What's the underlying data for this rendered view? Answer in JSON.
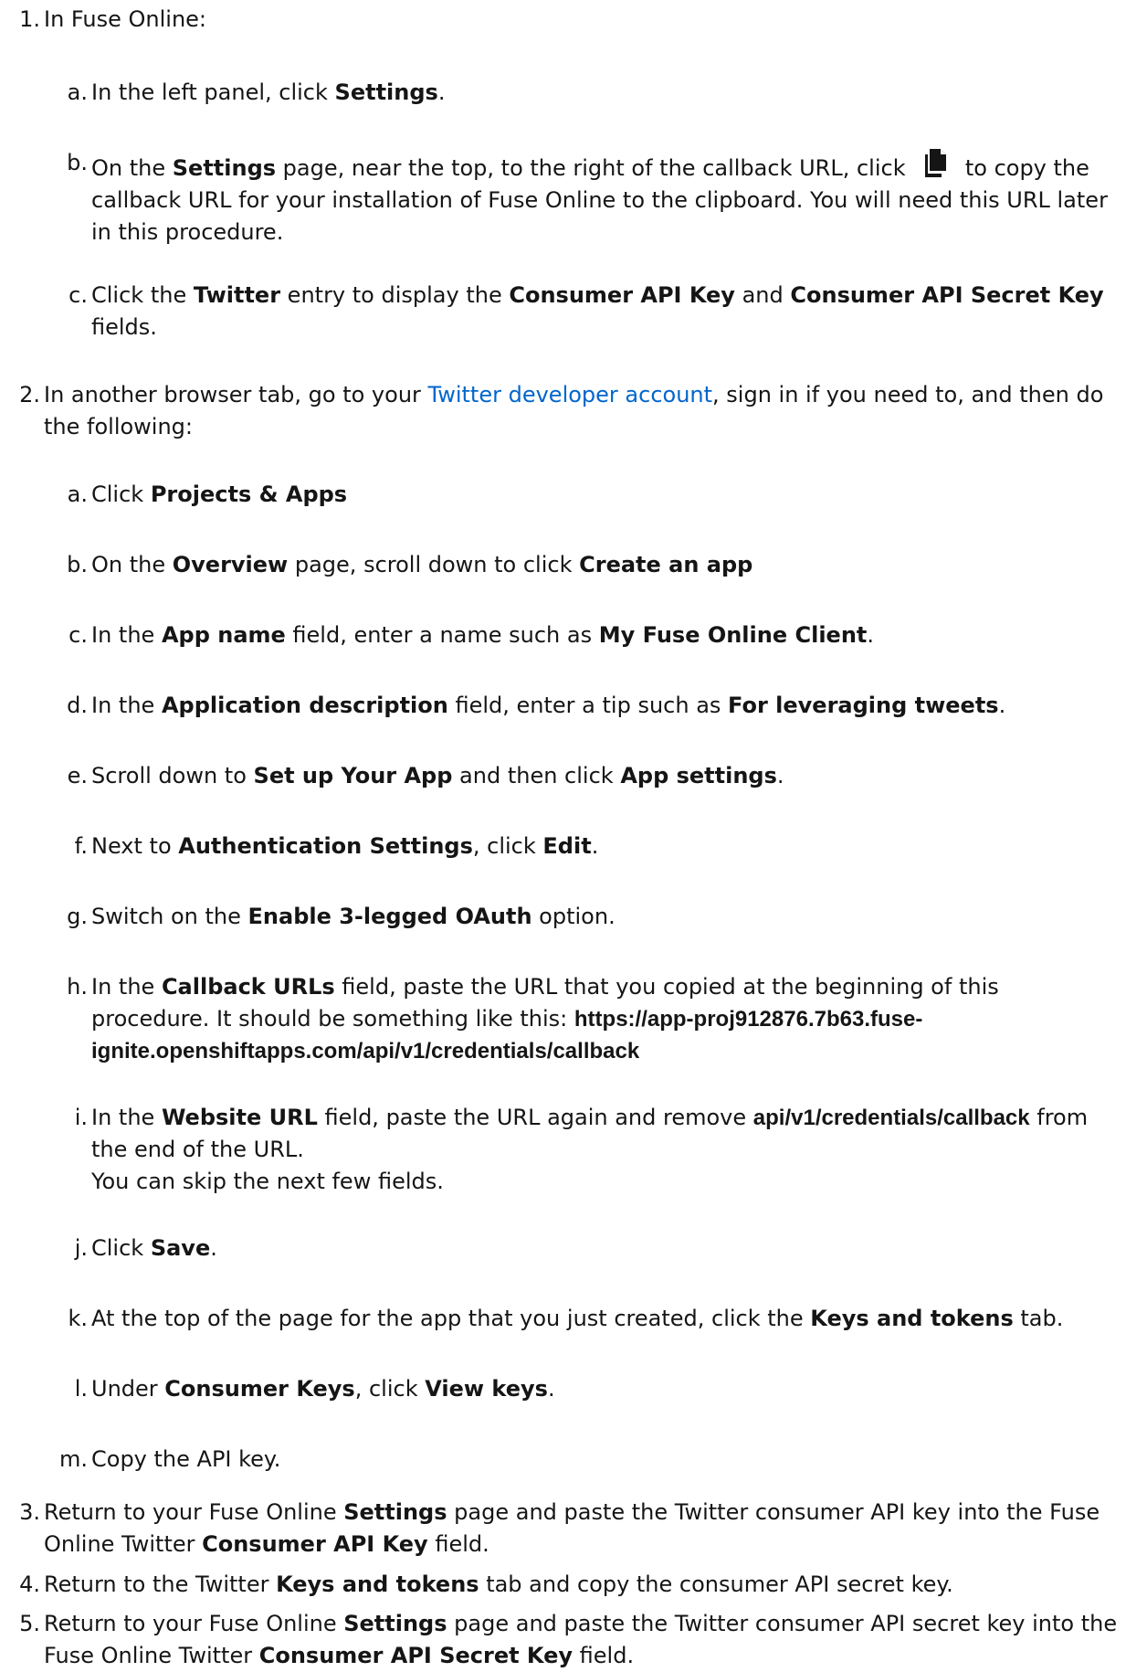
{
  "steps": [
    {
      "number": "1.",
      "text": "In Fuse Online:",
      "sub": [
        {
          "letter": "a.",
          "t1": "In the left panel, click ",
          "b1": "Settings",
          "t2": "."
        },
        {
          "letter": "b.",
          "t1": "On the ",
          "b1": "Settings",
          "t2": " page, near the top, to the right of the callback URL, click ",
          "icon": "copy-icon",
          "t3": " to copy the callback URL for your installation of Fuse Online to the clipboard. You will need this URL later in this procedure."
        },
        {
          "letter": "c.",
          "t1": "Click the ",
          "b1": "Twitter",
          "t2": " entry to display the ",
          "b2": "Consumer API Key",
          "t3": " and ",
          "b3": "Consumer API Secret Key",
          "t4": " fields."
        }
      ]
    },
    {
      "number": "2.",
      "t1": "In another browser tab, go to your ",
      "link": "Twitter developer account",
      "t2": ", sign in if you need to, and then do the following:",
      "sub": [
        {
          "letter": "a.",
          "t1": "Click ",
          "b1": "Projects & Apps"
        },
        {
          "letter": "b.",
          "t1": "On the ",
          "b1": "Overview",
          "t2": " page, scroll down to click ",
          "b2": "Create an app"
        },
        {
          "letter": "c.",
          "t1": "In the ",
          "b1": "App name",
          "t2": " field, enter a name such as ",
          "b2": "My Fuse Online Client",
          "t3": "."
        },
        {
          "letter": "d.",
          "t1": "In the ",
          "b1": "Application description",
          "t2": " field, enter a tip such as ",
          "b2": "For leveraging tweets",
          "t3": "."
        },
        {
          "letter": "e.",
          "t1": "Scroll down to ",
          "b1": "Set up Your App",
          "t2": " and then click ",
          "b2": "App settings",
          "t3": "."
        },
        {
          "letter": "f.",
          "t1": "Next to ",
          "b1": "Authentication Settings",
          "t2": ", click ",
          "b2": "Edit",
          "t3": "."
        },
        {
          "letter": "g.",
          "t1": "Switch on the ",
          "b1": "Enable 3-legged OAuth",
          "t2": " option."
        },
        {
          "letter": "h.",
          "t1": "In the ",
          "b1": "Callback URLs",
          "t2": " field, paste the URL that you copied at the beginning of this procedure. It should be something like this: ",
          "code": "https://app-proj912876.7b63.fuse-ignite.openshiftapps.com/api/v1/credentials/callback"
        },
        {
          "letter": "i.",
          "t1": "In the ",
          "b1": "Website URL",
          "t2": " field, paste the URL again and remove ",
          "code": "api/v1/credentials/callback",
          "t3": " from the end of the URL.",
          "t4": "You can skip the next few fields."
        },
        {
          "letter": "j.",
          "t1": "Click ",
          "b1": "Save",
          "t2": "."
        },
        {
          "letter": "k.",
          "t1": "At the top of the page for the app that you just created, click the ",
          "b1": "Keys and tokens",
          "t2": " tab."
        },
        {
          "letter": "l.",
          "t1": "Under ",
          "b1": "Consumer Keys",
          "t2": ", click ",
          "b2": "View keys",
          "t3": "."
        },
        {
          "letter": "m.",
          "t1": "Copy the API key."
        }
      ]
    },
    {
      "number": "3.",
      "t1": "Return to your Fuse Online ",
      "b1": "Settings",
      "t2": " page and paste the Twitter consumer API key into the Fuse Online Twitter ",
      "b2": "Consumer API Key",
      "t3": " field."
    },
    {
      "number": "4.",
      "t1": "Return to the Twitter ",
      "b1": "Keys and tokens",
      "t2": " tab and copy the consumer API secret key."
    },
    {
      "number": "5.",
      "t1": "Return to your Fuse Online ",
      "b1": "Settings",
      "t2": " page and paste the Twitter consumer API secret key into the Fuse Online Twitter ",
      "b2": "Consumer API Secret Key",
      "t3": " field."
    }
  ]
}
